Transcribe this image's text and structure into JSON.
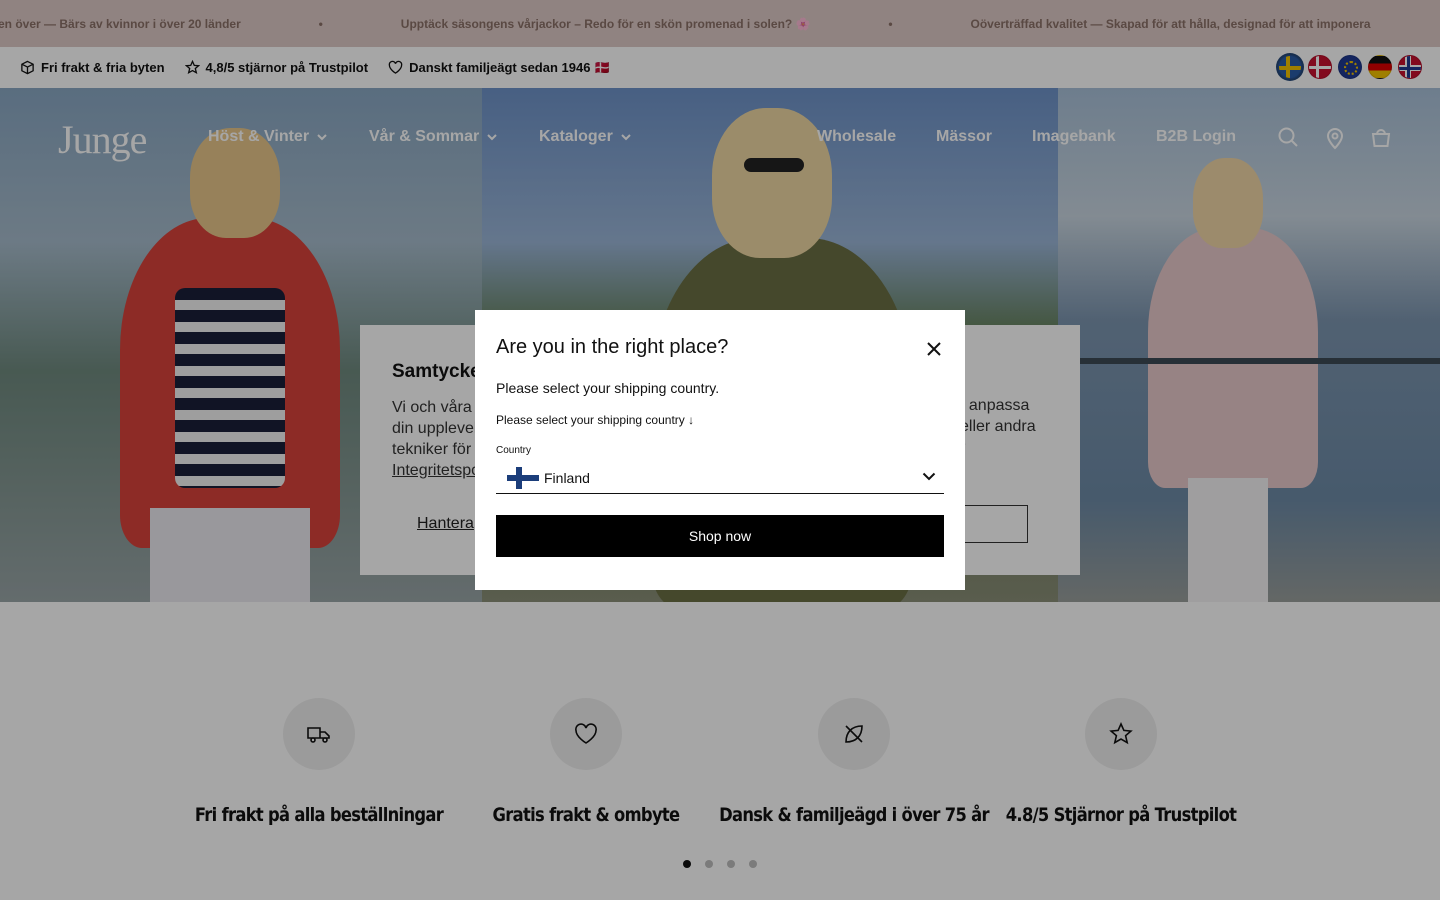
{
  "announcement": {
    "messages": [
      "en över — Bärs av kvinnor i över 20 länder",
      "Upptäck säsongens vårjackor – Redo för en skön promenad i solen? 🌸",
      "Oöverträffad kvalitet — Skapad för att hålla, designad för att imponera"
    ],
    "separator": "•"
  },
  "usp_bar": {
    "items": [
      {
        "label": "Fri frakt & fria byten",
        "icon": "box-icon"
      },
      {
        "label": "4,8/5 stjärnor på Trustpilot",
        "icon": "star-icon"
      },
      {
        "label": "Danskt familjeägt sedan 1946 🇩🇰",
        "icon": "heart-icon"
      }
    ],
    "flags": [
      "sweden",
      "denmark",
      "eu",
      "germany",
      "norway"
    ],
    "active_flag": "sweden"
  },
  "header": {
    "logo": "Junge",
    "nav": [
      {
        "label": "Höst & Vinter",
        "has_dropdown": true
      },
      {
        "label": "Vår & Sommar",
        "has_dropdown": true
      },
      {
        "label": "Kataloger",
        "has_dropdown": true
      },
      {
        "label": "Wholesale",
        "has_dropdown": false
      },
      {
        "label": "Mässor",
        "has_dropdown": false
      },
      {
        "label": "Imagebank",
        "has_dropdown": false
      },
      {
        "label": "B2B Login",
        "has_dropdown": false
      }
    ],
    "icons": [
      "search-icon",
      "location-icon",
      "cart-icon"
    ]
  },
  "consent": {
    "title": "Samtycke",
    "text": "Vi och våra\ndin upplevelse\ntekniker för",
    "link": "Integritetspo",
    "manage": "Hantera",
    "right_text": "t anpassa\neller andra\nr"
  },
  "modal": {
    "title": "Are you in the right place?",
    "subtitle": "Please select your shipping country.",
    "instruction": "Please select your shipping country ↓",
    "country_label": "Country",
    "country_value": "Finland",
    "button": "Shop now"
  },
  "features": [
    {
      "title": "Fri frakt på alla beställningar",
      "icon": "truck-icon"
    },
    {
      "title": "Gratis frakt & ombyte",
      "icon": "heart-icon"
    },
    {
      "title": "Dansk & familjeägd i över 75 år",
      "icon": "leaf-icon"
    },
    {
      "title": "4.8/5 Stjärnor på Trustpilot",
      "icon": "star-icon"
    }
  ],
  "carousel": {
    "total": 4,
    "active": 1
  },
  "colors": {
    "announce_bg": "#ddcac6",
    "button_bg": "#000000"
  }
}
